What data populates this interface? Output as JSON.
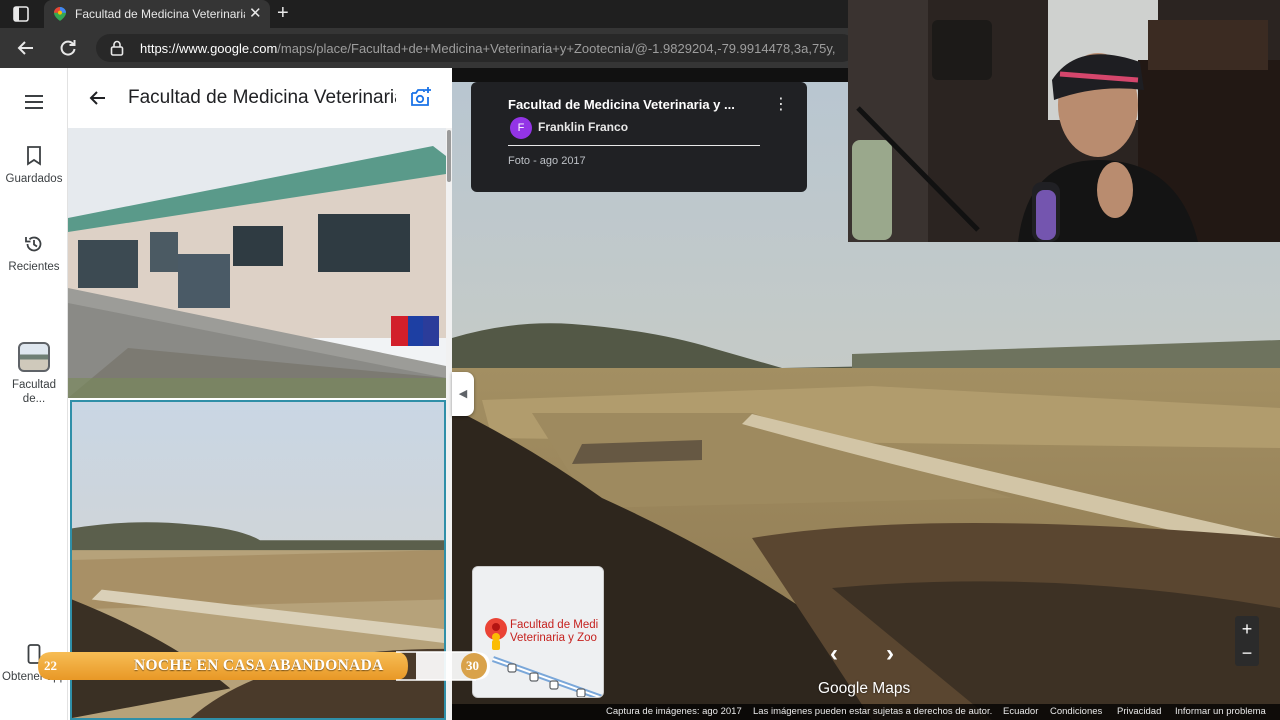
{
  "browser": {
    "tab_title": "Facultad de Medicina Veterinaria y",
    "url_host": "https://www.google.com",
    "url_path": "/maps/place/Facultad+de+Medicina+Veterinaria+y+Zootecnia/@-1.9829204,-79.9914478,3a,75y,"
  },
  "sidebar": {
    "items": [
      {
        "label": "Guardados",
        "icon": "bookmark-icon"
      },
      {
        "label": "Recientes",
        "icon": "history-icon"
      },
      {
        "label": "Facultad de...",
        "icon": "place-thumbnail"
      },
      {
        "label": "Obtener app",
        "icon": "phone-icon"
      }
    ]
  },
  "panel": {
    "title": "Facultad de Medicina Veterinaria y Zootecnia"
  },
  "photo_card": {
    "title": "Facultad de Medicina Veterinaria y ...",
    "avatar_letter": "F",
    "author": "Franklin Franco",
    "date": "Foto - ago 2017"
  },
  "minimap": {
    "label_line1": "Facultad de Medi",
    "label_line2": "Veterinaria y Zoo"
  },
  "branding": {
    "logo": "Google Maps"
  },
  "footer": {
    "capture": "Captura de imágenes: ago 2017",
    "rights": "Las imágenes pueden estar sujetas a derechos de autor.",
    "country": "Ecuador",
    "terms": "Condiciones",
    "privacy": "Privacidad",
    "report": "Informar un problema"
  },
  "stream_banner": {
    "left_number": "22",
    "title": "NOCHE EN CASA ABANDONADA",
    "right_number": "30"
  },
  "colors": {
    "accent": "#2f8fa8",
    "banner_gold": "#f0a53a",
    "card_bg": "#202124"
  }
}
